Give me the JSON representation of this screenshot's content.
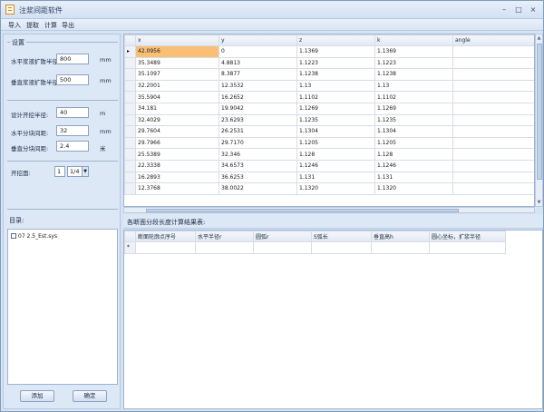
{
  "window": {
    "title": "注浆间距软件",
    "controls": [
      "–",
      "□",
      "×"
    ]
  },
  "menu": [
    "导入",
    "提取",
    "计算",
    "导出"
  ],
  "settings": {
    "group_title": "设置",
    "fields": [
      {
        "label": "水平浆液扩散半径:",
        "value": "800",
        "unit": "mm"
      },
      {
        "label": "垂直浆液扩散半径:",
        "value": "500",
        "unit": "mm"
      },
      {
        "label": "设计开挖半径:",
        "value": "40",
        "unit": "m"
      },
      {
        "label": "水平分块间距:",
        "value": "32",
        "unit": "mm"
      },
      {
        "label": "垂直分块间距:",
        "value": "2.4",
        "unit": "米"
      }
    ],
    "points_label": "开挖面:",
    "points_value": "1",
    "points_combo": "1/4",
    "catalog_label": "目录:",
    "file_item": "07 2.5_Est.sys",
    "btn_add": "添加",
    "btn_confirm": "确定"
  },
  "grid1": {
    "columns": [
      "x",
      "y",
      "z",
      "k",
      "angle"
    ],
    "rows": [
      [
        "42.0956",
        "0",
        "1.1369",
        "1.1369",
        ""
      ],
      [
        "35.3489",
        "4.8813",
        "1.1223",
        "1.1223",
        ""
      ],
      [
        "35.1097",
        "8.3877",
        "1.1238",
        "1.1238",
        ""
      ],
      [
        "32.2001",
        "12.3532",
        "1.13",
        "1.13",
        ""
      ],
      [
        "35.5904",
        "16.2652",
        "1.1102",
        "1.1102",
        ""
      ],
      [
        "34.181",
        "19.9042",
        "1.1269",
        "1.1269",
        ""
      ],
      [
        "32.4029",
        "23.6293",
        "1.1235",
        "1.1235",
        ""
      ],
      [
        "29.7604",
        "26.2531",
        "1.1304",
        "1.1304",
        ""
      ],
      [
        "29.7966",
        "29.7170",
        "1.1205",
        "1.1205",
        ""
      ],
      [
        "25.5389",
        "32.346",
        "1.128",
        "1.128",
        ""
      ],
      [
        "22.3338",
        "34.6573",
        "1.1246",
        "1.1246",
        ""
      ],
      [
        "16.2893",
        "36.6253",
        "1.131",
        "1.131",
        ""
      ],
      [
        "12.3768",
        "38.0022",
        "1.1320",
        "1.1320",
        ""
      ]
    ]
  },
  "grid2": {
    "section_label": "各断面分段长度计算结果表:",
    "columns": [
      "断面轮廓点序号",
      "水平半径r",
      "圆弧r",
      "S弧长",
      "垂直高h",
      "圆心坐标，扩浆半径"
    ]
  }
}
